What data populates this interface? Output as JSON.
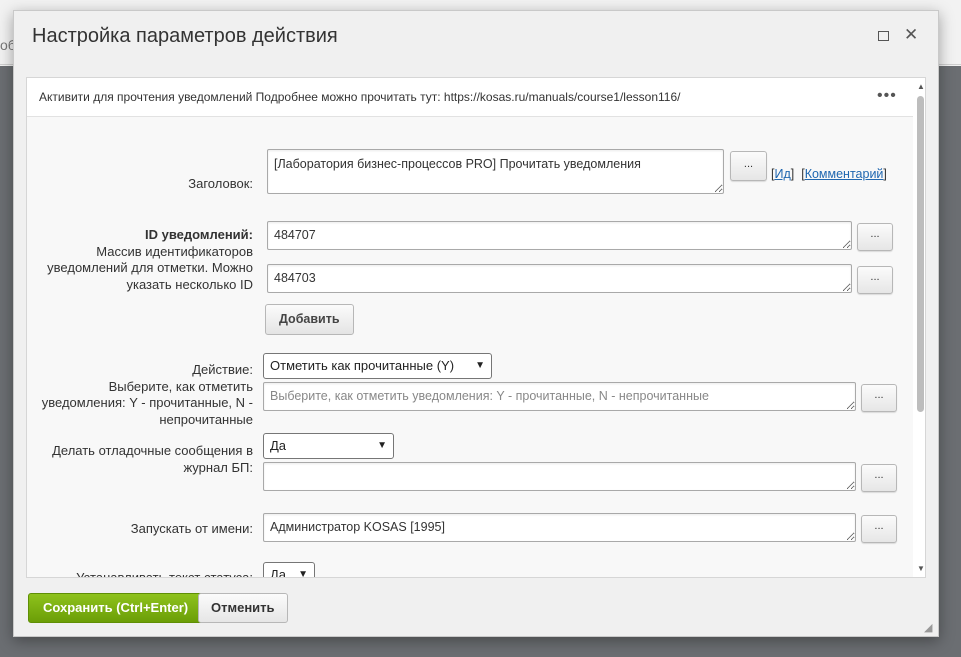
{
  "background": {
    "fragment": "об"
  },
  "dialog": {
    "title": "Настройка параметров действия",
    "maximize_icon": "square-icon",
    "close_icon": "close-icon",
    "close_glyph": "✕"
  },
  "description": {
    "text": "Активити для прочтения уведомлений Подробнее можно прочитать тут: https://kosas.ru/manuals/course1/lesson116/",
    "menu_glyph": "•••"
  },
  "fields": {
    "title": {
      "label": "Заголовок:",
      "value": "[Лаборатория бизнес-процессов PRO] Прочитать уведомления",
      "btn": "...",
      "id_link": "Ид",
      "comment_link": "Комментарий",
      "open_bracket": "[",
      "close_bracket": "]"
    },
    "notif_ids": {
      "label_bold": "ID уведомлений:",
      "label_desc": "Массив идентификаторов уведомлений для отметки. Можно указать несколько ID",
      "values": [
        "484707",
        "484703"
      ],
      "btn": "...",
      "add_label": "Добавить"
    },
    "action": {
      "label": "Действие:",
      "label_desc": "Выберите, как отметить уведомления: Y - прочитанные, N - непрочитанные",
      "selected": "Отметить как прочитанные (Y)",
      "placeholder": "Выберите, как отметить уведомления: Y - прочитанные, N - непрочитанные",
      "btn": "..."
    },
    "debug": {
      "label": "Делать отладочные сообщения в журнал БП:",
      "selected": "Да",
      "btn": "..."
    },
    "run_as": {
      "label": "Запускать от имени:",
      "value": "Администратор KOSAS [1995]",
      "btn": "..."
    },
    "status": {
      "label": "Устанавливать текст статуса:",
      "selected": "Да"
    }
  },
  "footer": {
    "save_label": "Сохранить (Ctrl+Enter)",
    "cancel_label": "Отменить"
  },
  "colors": {
    "accent_green": "#7db310",
    "link_blue": "#2067b0"
  }
}
